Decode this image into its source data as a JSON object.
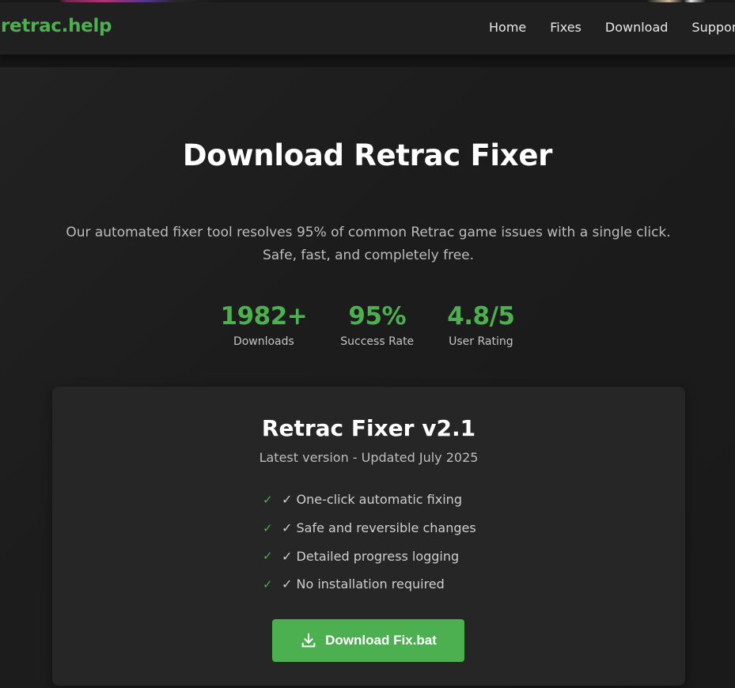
{
  "nav": {
    "logo": "retrac.help",
    "links": [
      "Home",
      "Fixes",
      "Download",
      "Support"
    ]
  },
  "hero": {
    "title": "Download Retrac Fixer",
    "description": "Our automated fixer tool resolves 95% of common Retrac game issues with a single click. Safe, fast, and completely free."
  },
  "stats": [
    {
      "value": "1982+",
      "label": "Downloads"
    },
    {
      "value": "95%",
      "label": "Success Rate"
    },
    {
      "value": "4.8/5",
      "label": "User Rating"
    }
  ],
  "card": {
    "title": "Retrac Fixer v2.1",
    "subtitle": "Latest version - Updated July 2025",
    "check_glyph": "✓",
    "features": [
      "✓ One-click automatic fixing",
      "✓ Safe and reversible changes",
      "✓ Detailed progress logging",
      "✓ No installation required"
    ],
    "button_label": "Download Fix.bat",
    "button_icon": "download-icon"
  },
  "colors": {
    "accent": "#4caf50",
    "background": "#151515",
    "navbar": "#202020",
    "card": "#262626"
  }
}
